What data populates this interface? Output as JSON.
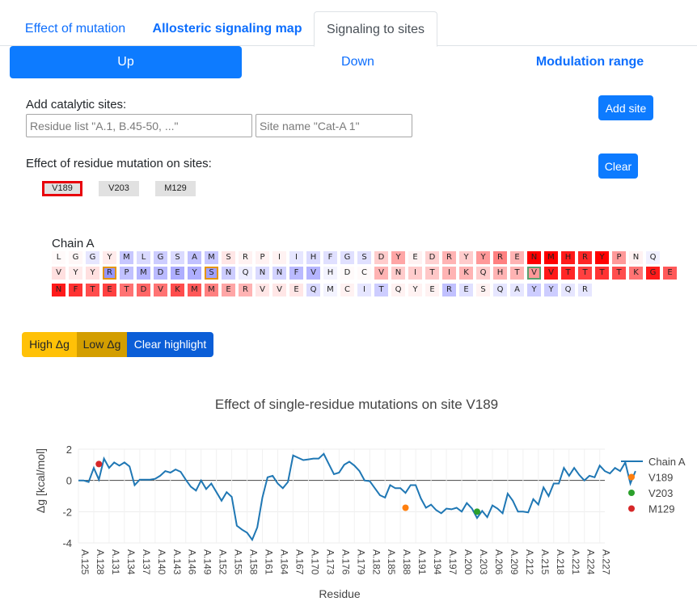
{
  "tabs": [
    "Effect of mutation",
    "Allosteric signaling map",
    "Signaling to sites"
  ],
  "pills": [
    "Up",
    "Down",
    "Modulation range"
  ],
  "catalytic": {
    "label": "Add catalytic sites:",
    "residue_placeholder": "Residue list \"A.1, B.45-50, ...\"",
    "name_placeholder": "Site name \"Cat-A 1\"",
    "add_button": "Add site"
  },
  "effect": {
    "label": "Effect of residue mutation on sites:",
    "clear_button": "Clear",
    "sites": [
      "V189",
      "V203",
      "M129"
    ],
    "selected_site": "V189"
  },
  "chain": {
    "label": "Chain A",
    "rows": [
      {
        "letters": [
          "L",
          "G",
          "G",
          "Y",
          "M",
          "L",
          "G",
          "S",
          "A",
          "M",
          "S",
          "R",
          "P",
          "I",
          "I",
          "H",
          "F",
          "G",
          "S",
          "D",
          "Y",
          "E",
          "D",
          "R",
          "Y",
          "Y",
          "R",
          "E",
          "N",
          "M",
          "H",
          "R",
          "Y",
          "P",
          "N",
          "Q"
        ],
        "values": [
          0.02,
          0.03,
          -0.2,
          0.08,
          -0.45,
          -0.3,
          -0.4,
          -0.3,
          -0.5,
          -0.45,
          0.1,
          0.05,
          0.05,
          0.05,
          -0.2,
          -0.3,
          -0.25,
          -0.25,
          -0.25,
          0.2,
          0.35,
          0.05,
          0.18,
          0.3,
          0.2,
          0.4,
          0.5,
          0.3,
          1.0,
          1.0,
          0.9,
          0.85,
          1.0,
          0.4,
          0.05,
          -0.12
        ]
      },
      {
        "letters": [
          "V",
          "Y",
          "Y",
          "R",
          "P",
          "M",
          "D",
          "E",
          "Y",
          "S",
          "N",
          "Q",
          "N",
          "N",
          "F",
          "V",
          "H",
          "D",
          "C",
          "V",
          "N",
          "I",
          "T",
          "I",
          "K",
          "Q",
          "H",
          "T",
          "V",
          "V",
          "T",
          "T",
          "T",
          "T",
          "K",
          "G",
          "E"
        ],
        "values": [
          0.12,
          0.08,
          0.12,
          -0.85,
          -0.5,
          -0.6,
          -0.55,
          -0.65,
          -0.65,
          -0.75,
          -0.4,
          -0.15,
          -0.3,
          -0.35,
          -0.55,
          -0.6,
          -0.1,
          0.02,
          0.02,
          0.3,
          0.2,
          0.2,
          0.22,
          0.3,
          0.3,
          0.2,
          0.3,
          0.3,
          0.4,
          0.9,
          0.85,
          0.75,
          0.8,
          0.7,
          0.55,
          0.9,
          0.65
        ],
        "highlight": {
          "3": "orange",
          "9": "orange",
          "28": "green"
        }
      },
      {
        "letters": [
          "N",
          "F",
          "T",
          "E",
          "T",
          "D",
          "V",
          "K",
          "M",
          "M",
          "E",
          "R",
          "V",
          "V",
          "E",
          "Q",
          "M",
          "C",
          "I",
          "T",
          "Q",
          "Y",
          "E",
          "R",
          "E",
          "S",
          "Q",
          "A",
          "Y",
          "Y",
          "Q",
          "R"
        ],
        "values": [
          0.9,
          0.8,
          0.7,
          0.75,
          0.55,
          0.6,
          0.55,
          0.7,
          0.65,
          0.5,
          0.35,
          0.3,
          0.1,
          0.1,
          0.1,
          -0.3,
          -0.1,
          0.05,
          -0.2,
          -0.4,
          0.05,
          0.05,
          0.05,
          -0.5,
          -0.25,
          0.05,
          -0.2,
          -0.2,
          -0.4,
          -0.4,
          -0.2,
          -0.2
        ]
      }
    ]
  },
  "highlight_buttons": [
    "High Δg",
    "Low Δg",
    "Clear highlight"
  ],
  "colors": {
    "accent": "#0d7bff",
    "high": "#ffc107",
    "low": "#d39e00",
    "clear": "#0b5ed7",
    "series": "#1f77b4",
    "v189": "#ff7f0e",
    "v203": "#2ca02c",
    "m129": "#d62728"
  },
  "chart_data": {
    "type": "line",
    "title": "Effect of single-residue mutations on site V189",
    "xlabel": "Residue",
    "ylabel": "Δg [kcal/mol]",
    "ylim": [
      -4,
      2
    ],
    "yticks": [
      2,
      0,
      -2,
      -4
    ],
    "x_start": 125,
    "x_end": 228,
    "xtick_labels": [
      "A.125",
      "A.128",
      "A.131",
      "A.134",
      "A.137",
      "A.140",
      "A.143",
      "A.146",
      "A.149",
      "A.152",
      "A.155",
      "A.158",
      "A.161",
      "A.164",
      "A.167",
      "A.170",
      "A.173",
      "A.176",
      "A.179",
      "A.182",
      "A.185",
      "A.188",
      "A.191",
      "A.194",
      "A.197",
      "A.200",
      "A.203",
      "A.206",
      "A.209",
      "A.212",
      "A.215",
      "A.218",
      "A.221",
      "A.224",
      "A.227"
    ],
    "legend": [
      "Chain A",
      "V189",
      "V203",
      "M129"
    ],
    "series": [
      {
        "name": "Chain A",
        "values": [
          0,
          0,
          -0.1,
          0.8,
          0.05,
          1.4,
          0.8,
          1.15,
          0.95,
          1.15,
          0.9,
          -0.3,
          0.05,
          0.05,
          0.05,
          0.1,
          0.3,
          0.6,
          0.5,
          0.7,
          0.55,
          0.05,
          -0.4,
          -0.65,
          0,
          -0.55,
          -0.2,
          -0.75,
          -1.3,
          -0.75,
          -1.05,
          -2.9,
          -3.15,
          -3.35,
          -3.8,
          -3.0,
          -1.1,
          0.2,
          0.3,
          -0.2,
          -0.5,
          -0.1,
          1.6,
          1.45,
          1.3,
          1.35,
          1.4,
          1.4,
          1.7,
          1.05,
          0.4,
          0.5,
          1.0,
          1.2,
          0.95,
          0.6,
          0,
          -0.05,
          -0.5,
          -0.95,
          -1.1,
          -0.3,
          -0.5,
          -0.5,
          -0.8,
          -0.3,
          -0.3,
          -1.15,
          -1.75,
          -1.55,
          -1.9,
          -2.1,
          -1.8,
          -1.85,
          -1.75,
          -2.0,
          -1.45,
          -1.8,
          -2.4,
          -1.95,
          -2.35,
          -1.6,
          -1.8,
          -2.1,
          -0.85,
          -1.3,
          -2.0,
          -2.0,
          -2.05,
          -1.2,
          -1.55,
          -0.45,
          -1.0,
          -0.2,
          -0.2,
          0.8,
          0.3,
          0.8,
          0.35,
          0,
          0.3,
          0.2,
          0.95,
          0.6,
          0.45,
          0.8,
          0.6,
          1.15,
          -0.2,
          0.6
        ]
      },
      {
        "name": "V189",
        "points": [
          [
            189,
            -1.75
          ]
        ]
      },
      {
        "name": "V203",
        "points": [
          [
            203,
            -2.0
          ]
        ]
      },
      {
        "name": "M129",
        "points": [
          [
            129,
            1.05
          ]
        ]
      }
    ]
  }
}
